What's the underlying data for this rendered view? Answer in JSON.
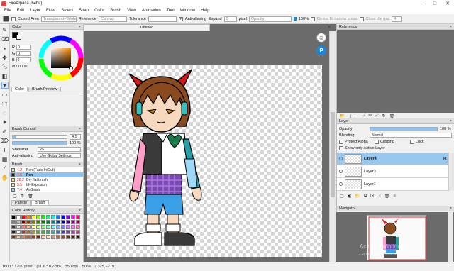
{
  "window": {
    "title": "FireAlpaca (64bit)",
    "controls": [
      "–",
      "□",
      "✕"
    ]
  },
  "menu": [
    "File",
    "Edit",
    "Layer",
    "Filter",
    "Select",
    "Snap",
    "Color",
    "Brush",
    "View",
    "Animation",
    "Tool",
    "Window",
    "Help"
  ],
  "toolopts": {
    "closed_area": "Closed Area",
    "transparent_white": "Transparent+White",
    "reference": "Reference",
    "reference_value": "Canvas",
    "tolerance": "Tolerance",
    "anti_aliasing": "Anti-aliasing",
    "expand": "Expand",
    "expand_value": "0",
    "pixel": "pixel",
    "opacity": "Opacity",
    "opacity_value": "100%",
    "opacity_fraction": 1.0,
    "no_narrow": "Do not fill narrow areas",
    "close_gap": "Close the gap",
    "close_gap_value": "4"
  },
  "document": {
    "tab": "Untitled",
    "close": "×"
  },
  "color_panel": {
    "header": "Color",
    "r_label": "R",
    "r_value": "0",
    "g_label": "G",
    "g_value": "0",
    "b_label": "B",
    "b_value": "0",
    "hex": "#000000",
    "tab_color": "Color",
    "tab_preview": "Brush Preview"
  },
  "brush_control": {
    "header": "Brush Control",
    "size_value": "4.5",
    "opacity_value": "100 %",
    "stabilizer_label": "Stabilizer",
    "stabilizer_value": "25",
    "aa_label": "Anti-aliasing",
    "aa_value": "Use Global Settings"
  },
  "brush_panel": {
    "header": "Brush",
    "items": [
      {
        "size": "4.2",
        "name": "Pen (Fade In/Out)"
      },
      {
        "size": "4.5",
        "name": "Pen"
      },
      {
        "size": "28.2",
        "name": "Dry flat brush"
      },
      {
        "size": "5.5",
        "name": "fd- Explosion"
      },
      {
        "size": "7.4",
        "name": "AirBrush"
      }
    ],
    "tab_palette": "Palette",
    "tab_brush": "Brush"
  },
  "color_history": {
    "header": "Color History",
    "colors": [
      "#000000",
      "#ffffff",
      "#ff0000",
      "#ff7f00",
      "#ffff00",
      "#7fff00",
      "#00ff00",
      "#00ff7f",
      "#00ffff",
      "#007fff",
      "#0000ff",
      "#7f00ff",
      "#ff00ff",
      "#ff007f",
      "#7f7f7f",
      "#c0c0c0",
      "#800000",
      "#804000",
      "#808000",
      "#408000",
      "#008000",
      "#008040",
      "#008080",
      "#004080",
      "#000080",
      "#400080",
      "#800080",
      "#800040",
      "#3f3f3f",
      "#e0e0e0",
      "#ff8080",
      "#ffc080",
      "#ffff80",
      "#c0ff80",
      "#80ff80",
      "#80ffc0",
      "#80ffff",
      "#80c0ff",
      "#8080ff",
      "#c080ff",
      "#ff80ff",
      "#ff80c0",
      "#202020",
      "#f5f5f5",
      "#a04040",
      "#a07040",
      "#a0a040",
      "#70a040",
      "#40a040",
      "#40a070",
      "#40a0a0",
      "#4070a0",
      "#4040a0",
      "#7040a0",
      "#a040a0",
      "#a04070",
      "#6a3a1a",
      "#f0c8a0",
      "#d09070",
      "#b06030",
      "#904020",
      "#703010",
      "#ffd0b0",
      "#ffe0c0",
      "#d0a080",
      "#a07050",
      "#805030",
      "#603018",
      "#402010",
      "#201008"
    ]
  },
  "reference": {
    "header": "Reference"
  },
  "layer_panel": {
    "header": "Layer",
    "opacity_label": "Opacity",
    "opacity_value": "100 %",
    "opacity_fraction": 1.0,
    "blending_label": "Blending",
    "blending_value": "Normal",
    "protect_alpha": "Protect Alpha",
    "clipping": "Clipping",
    "lock": "Lock",
    "show_only_active": "Show only Active Layer",
    "layers": [
      {
        "name": "Layer4"
      },
      {
        "name": "Layer3"
      },
      {
        "name": "Layer1"
      }
    ]
  },
  "navigator": {
    "header": "Navigator"
  },
  "status": {
    "size": "1600 * 1200 pixel",
    "cm": "(11.6 * 8.7cm)",
    "dpi": "350 dpi",
    "zoom": "50 %",
    "coords": "( 325, -219 )"
  },
  "watermark": {
    "line1": "Activate Windows",
    "line2": "Go to Settings to activate Windows."
  }
}
